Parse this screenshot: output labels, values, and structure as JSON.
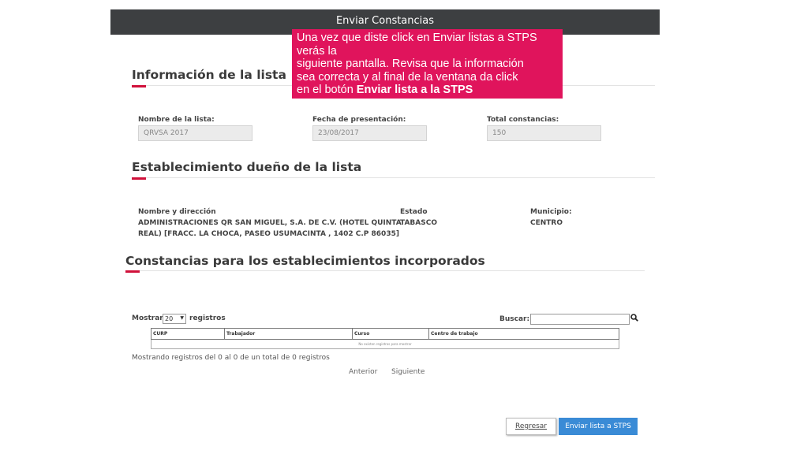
{
  "header": {
    "title": "Enviar Constancias"
  },
  "tooltip": {
    "line1": "Una vez que diste click en Enviar listas a STPS",
    "line2": "verás la",
    "line3": "siguiente pantalla. Revisa que la información",
    "line4": "sea correcta y al final de la ventana da click",
    "line5_prefix": "en el botón ",
    "line5_bold": "Enviar lista a la STPS"
  },
  "lista": {
    "title": "Información de la lista",
    "nombre_label": "Nombre de la lista:",
    "nombre_value": "QRVSA 2017",
    "fecha_label": "Fecha de presentación:",
    "fecha_value": "23/08/2017",
    "total_label": "Total constancias:",
    "total_value": "150"
  },
  "establecimiento": {
    "title": "Establecimiento dueño de la lista",
    "nombre_label": "Nombre y dirección",
    "nombre_line1": "ADMINISTRACIONES QR SAN MIGUEL, S.A. DE C.V. (HOTEL QUINTA",
    "nombre_line2": "REAL) [FRACC. LA CHOCA, PASEO USUMACINTA , 1402 C.P 86035]",
    "estado_label": "Estado",
    "estado_value": "TABASCO",
    "municipio_label": "Municipio:",
    "municipio_value": "CENTRO"
  },
  "constancias": {
    "title": "Constancias para los establecimientos incorporados",
    "mostrar_label": "Mostrar",
    "page_size": "20",
    "registros_label": "registros",
    "buscar_label": "Buscar:",
    "search_value": "",
    "columns": [
      "CURP",
      "Trabajador",
      "Curso",
      "Centro de trabajo"
    ],
    "empty_message": "No existen registros para mostrar",
    "info": "Mostrando registros del 0 al 0 de un total de 0 registros",
    "prev_label": "Anterior",
    "next_label": "Siguiente"
  },
  "actions": {
    "back_label": "Regresar",
    "send_label": "Enviar lista a STPS"
  },
  "colors": {
    "header_bg": "#3d3f41",
    "tooltip_bg": "#e0145c",
    "accent": "#d0103a",
    "primary_button": "#3a8bd6"
  },
  "icons": {
    "search": "search-icon",
    "dropdown": "chevron-down-icon"
  }
}
